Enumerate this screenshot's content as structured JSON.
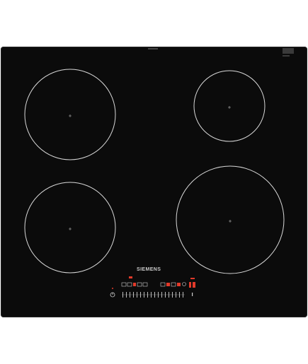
{
  "product": {
    "brand": "SIEMENS"
  },
  "colors": {
    "glass": "#0b0b0b",
    "zone_outline": "#d8d8d8",
    "touch_control_white": "#cfcfcf",
    "touch_control_red": "#e23a2a"
  },
  "cooking_zones": [
    {
      "id": "rear-left"
    },
    {
      "id": "rear-right"
    },
    {
      "id": "front-left"
    },
    {
      "id": "front-right"
    }
  ],
  "control_panel": {
    "has_power_button": true,
    "has_slider": true,
    "has_timer": true
  }
}
